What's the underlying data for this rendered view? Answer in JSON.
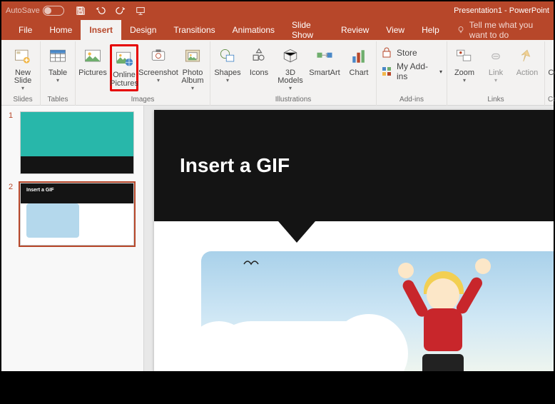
{
  "titlebar": {
    "autosave_label": "AutoSave",
    "autosave_state": "Off",
    "document_title": "Presentation1 - PowerPoint"
  },
  "tabs": {
    "file": "File",
    "home": "Home",
    "insert": "Insert",
    "design": "Design",
    "transitions": "Transitions",
    "animations": "Animations",
    "slideshow": "Slide Show",
    "review": "Review",
    "view": "View",
    "help": "Help",
    "tellme": "Tell me what you want to do"
  },
  "ribbon": {
    "groups": {
      "slides": {
        "label": "Slides",
        "new_slide": "New Slide"
      },
      "tables": {
        "label": "Tables",
        "table": "Table"
      },
      "images": {
        "label": "Images",
        "pictures": "Pictures",
        "online_pictures": "Online Pictures",
        "screenshot": "Screenshot",
        "photo_album": "Photo Album"
      },
      "illustrations": {
        "label": "Illustrations",
        "shapes": "Shapes",
        "icons": "Icons",
        "threed": "3D Models",
        "smartart": "SmartArt",
        "chart": "Chart"
      },
      "addins": {
        "label": "Add-ins",
        "store": "Store",
        "my_addins": "My Add-ins"
      },
      "links": {
        "label": "Links",
        "zoom": "Zoom",
        "link": "Link",
        "action": "Action"
      },
      "comments": {
        "label": "Comments",
        "comment": "Comment"
      }
    }
  },
  "thumbnails": {
    "n1": "1",
    "n2": "2",
    "thumb2_title": "Insert a GIF"
  },
  "slide": {
    "title": "Insert a GIF"
  }
}
